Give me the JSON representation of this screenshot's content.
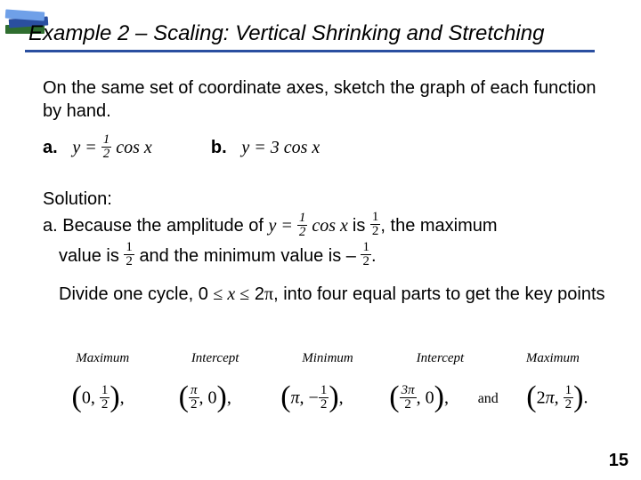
{
  "title": "Example 2 – Scaling: Vertical Shrinking and Stretching",
  "intro": {
    "line1": "On the same set of coordinate axes, sketch the graph of each function by hand.",
    "a_label": "a.",
    "a_eq_prefix": "y = ",
    "a_eq_frac_n": "1",
    "a_eq_frac_d": "2",
    "a_eq_suffix": " cos x",
    "b_label": "b.",
    "b_eq": "y = 3 cos x"
  },
  "solution": {
    "heading": "Solution:",
    "a_text_1": "a. Because the amplitude of ",
    "a_eq2_prefix": "y = ",
    "a_eq2_frac_n": "1",
    "a_eq2_frac_d": "2",
    "a_eq2_suffix": " cos x",
    "a_text_2": " is ",
    "amp_frac_n": "1",
    "amp_frac_d": "2",
    "a_text_3": ", the maximum",
    "a_line2_1": "value is ",
    "max_frac_n": "1",
    "max_frac_d": "2",
    "a_line2_2": " and the minimum value is – ",
    "min_frac_n": "1",
    "min_frac_d": "2",
    "a_line2_3": ".",
    "divide_1": "Divide one cycle, 0 ",
    "le1": "≤",
    "divide_x": " x ",
    "le2": "≤",
    "divide_2": " 2",
    "pi": "π",
    "divide_3": ", into four equal parts to get the key points"
  },
  "kp": {
    "labels": [
      "Maximum",
      "Intercept",
      "Minimum",
      "Intercept",
      "Maximum"
    ],
    "pt1_x": "0",
    "pt1_yn": "1",
    "pt1_yd": "2",
    "pt2_xn": "π",
    "pt2_xd": "2",
    "pt2_y": "0",
    "pt3_x": "π",
    "pt3_yn": "1",
    "pt3_yd": "2",
    "pt3_neg": "−",
    "pt4_xn": "3π",
    "pt4_xd": "2",
    "pt4_y": "0",
    "pt5_x": "2π",
    "pt5_yn": "1",
    "pt5_yd": "2",
    "and": "and",
    "comma": ",",
    "period": "."
  },
  "pageno": "15"
}
